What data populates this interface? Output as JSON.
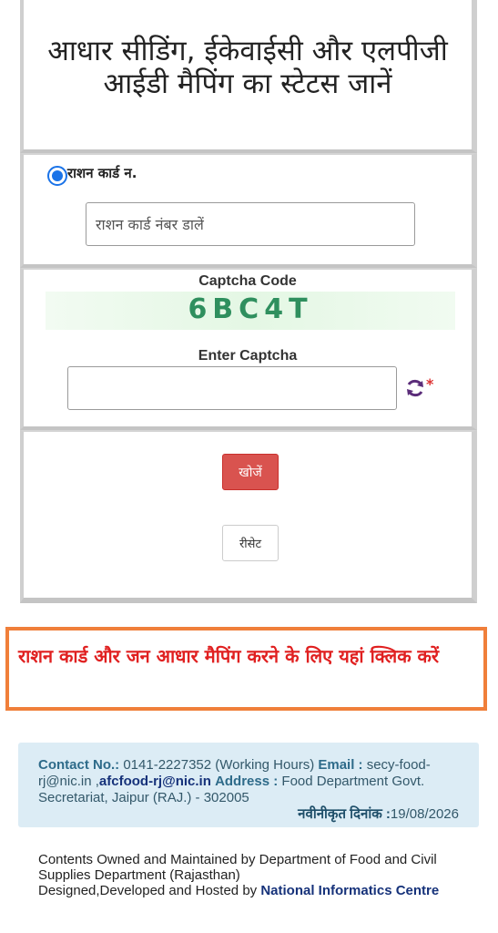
{
  "title": "आधार सीडिंग, ईकेवाईसी और एलपीजी आईडी मैपिंग का स्टेटस जानें",
  "ration_card": {
    "radio_label": "राशन कार्ड न.",
    "input_placeholder": "राशन कार्ड नंबर डालें",
    "input_value": ""
  },
  "captcha": {
    "heading": "Captcha Code",
    "code": "6BC4T",
    "enter_label": "Enter Captcha",
    "input_value": "",
    "refresh_icon": "refresh-icon",
    "required_mark": "*"
  },
  "buttons": {
    "search_label": "खोजें",
    "reset_label": "रीसेट"
  },
  "mapping_link": "राशन कार्ड और जन आधार मैपिंग करने के लिए यहां क्लिक करें",
  "contact": {
    "contact_label": "Contact No.:",
    "phone": "0141-2227352 (Working Hours)",
    "email_label": "Email :",
    "email_1": "secy-food-rj@nic.in",
    "email_2": "afcfood-rj@nic.in",
    "address_label": "Address :",
    "address": "Food Department Govt. Secretariat, Jaipur (RAJ.) - 302005",
    "updated_label": "नवीनीकृत दिनांक :",
    "updated_date": "19/08/2026"
  },
  "footer": {
    "line1": "Contents Owned and Maintained by Department of Food and Civil Supplies Department (Rajasthan)",
    "line2_prefix": "Designed,Developed and Hosted by",
    "nic": "National Informatics Centre"
  },
  "colors": {
    "search_button": "#d9534f",
    "mapping_border": "#f07f3a",
    "mapping_text": "#e02020",
    "contact_background": "#dcecf5",
    "radio": "#1a73e8"
  }
}
